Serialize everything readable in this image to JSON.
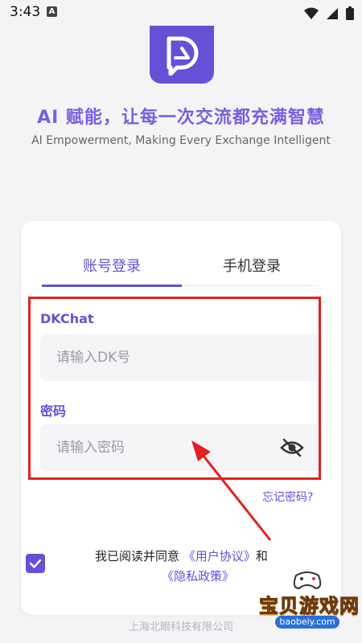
{
  "status_bar": {
    "time": "3:43",
    "badge": "A",
    "icons": [
      "wifi-icon",
      "signal-icon",
      "battery-icon"
    ]
  },
  "branding": {
    "logo_icon": "dkchat-logo",
    "slogan_cn": "AI 赋能，让每一次交流都充满智慧",
    "slogan_en": "AI Empowerment, Making Every Exchange Intelligent"
  },
  "login": {
    "tabs": [
      {
        "label": "账号登录",
        "active": true
      },
      {
        "label": "手机登录",
        "active": false
      }
    ],
    "account_label": "DKChat",
    "account_placeholder": "请输入DK号",
    "account_value": "",
    "password_label": "密码",
    "password_placeholder": "请输入密码",
    "password_value": "",
    "password_toggle_icon": "eye-off-icon",
    "forgot_label": "忘记密码?"
  },
  "agreement": {
    "checked": true,
    "prefix": "我已阅读并同意",
    "user_agreement": "《用户协议》",
    "and": "和",
    "privacy_policy": "《隐私政策》"
  },
  "footer": {
    "company": "上海北眼科技有限公司"
  },
  "watermark": {
    "title": "宝贝游戏网",
    "url": "baobeiy.com"
  },
  "colors": {
    "accent": "#6650d6",
    "highlight_box": "#e52020",
    "background": "#f4f4f7"
  }
}
